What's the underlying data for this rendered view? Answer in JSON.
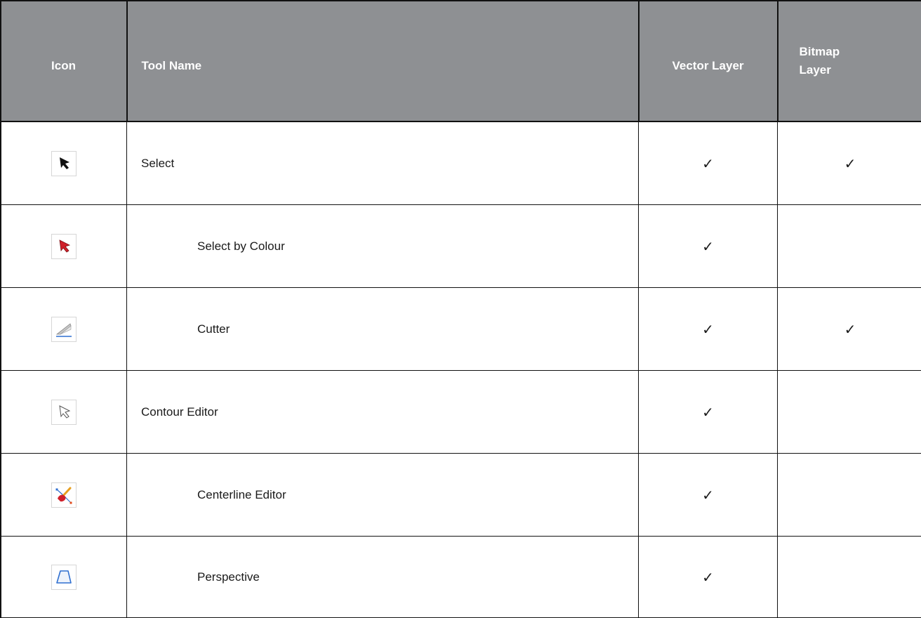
{
  "header": {
    "icon": "Icon",
    "tool_name": "Tool Name",
    "vector_layer": "Vector Layer",
    "bitmap_layer_line1": "Bitmap",
    "bitmap_layer_line2": "Layer"
  },
  "rows": [
    {
      "icon": "select-arrow-icon",
      "name": "Select",
      "indent": false,
      "vector": "✓",
      "bitmap": "✓"
    },
    {
      "icon": "select-by-colour-icon",
      "name": "Select by Colour",
      "indent": true,
      "vector": "✓",
      "bitmap": ""
    },
    {
      "icon": "cutter-icon",
      "name": "Cutter",
      "indent": true,
      "vector": "✓",
      "bitmap": "✓"
    },
    {
      "icon": "contour-editor-icon",
      "name": "Contour Editor",
      "indent": false,
      "vector": "✓",
      "bitmap": ""
    },
    {
      "icon": "centerline-editor-icon",
      "name": "Centerline Editor",
      "indent": true,
      "vector": "✓",
      "bitmap": ""
    },
    {
      "icon": "perspective-icon",
      "name": "Perspective",
      "indent": true,
      "vector": "✓",
      "bitmap": ""
    }
  ],
  "colors": {
    "header_bg": "#8e9093",
    "header_text": "#ffffff",
    "border": "#111111"
  }
}
